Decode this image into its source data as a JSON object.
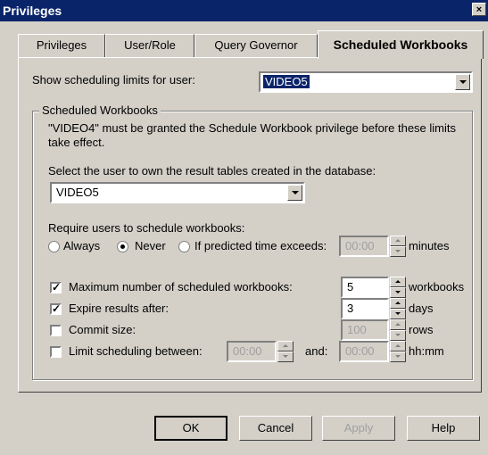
{
  "window": {
    "title": "Privileges",
    "close_label": "×"
  },
  "tabs": [
    {
      "label": "Privileges",
      "active": false
    },
    {
      "label": "User/Role",
      "active": false
    },
    {
      "label": "Query Governor",
      "active": false
    },
    {
      "label": "Scheduled Workbooks",
      "active": true
    }
  ],
  "show_limits": {
    "label": "Show scheduling limits for user:",
    "value": "VIDEO5"
  },
  "group": {
    "title": "Scheduled Workbooks",
    "notice": "\"VIDEO4\" must be granted the Schedule Workbook privilege before these limits take effect.",
    "owner_label": "Select the user to own the result tables created in the database:",
    "owner_value": "VIDEO5",
    "require_label": "Require users to schedule workbooks:",
    "options": [
      {
        "label": "Always",
        "selected": false
      },
      {
        "label": "Never",
        "selected": true
      },
      {
        "label": "If predicted time exceeds:",
        "selected": false
      }
    ],
    "predicted_time": "00:00",
    "predicted_unit": "minutes",
    "limits": [
      {
        "label": "Maximum number of scheduled workbooks:",
        "checked": true,
        "value": "5",
        "unit": "workbooks",
        "enabled": true
      },
      {
        "label": "Expire results after:",
        "checked": true,
        "value": "3",
        "unit": "days",
        "enabled": true
      },
      {
        "label": "Commit size:",
        "checked": false,
        "value": "100",
        "unit": "rows",
        "enabled": false
      }
    ],
    "between": {
      "label": "Limit scheduling between:",
      "checked": false,
      "start": "00:00",
      "and_label": "and:",
      "end": "00:00",
      "unit": "hh:mm"
    }
  },
  "buttons": {
    "ok": "OK",
    "cancel": "Cancel",
    "apply": "Apply",
    "help": "Help"
  }
}
